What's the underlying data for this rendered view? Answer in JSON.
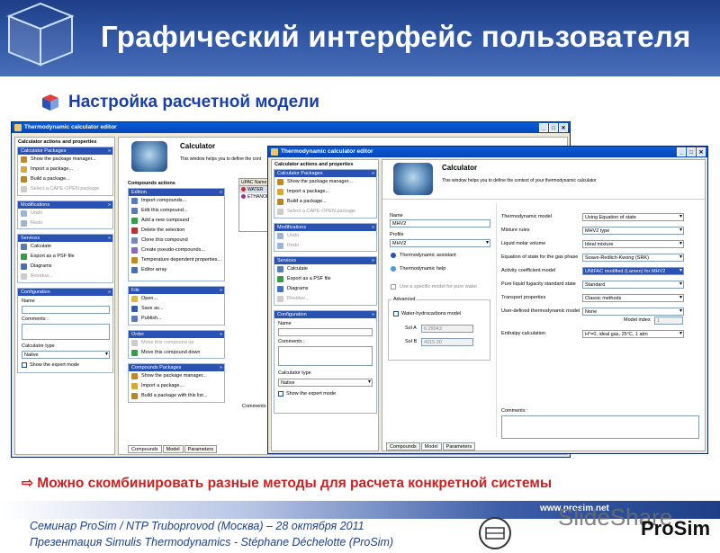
{
  "slide": {
    "title": "Графический интерфейс пользователя",
    "subtitle": "Настройка расчетной модели",
    "bottom_note": "⇨ Можно скомбинировать разные методы для расчета конкретной системы",
    "footer_line1": "Семинар ProSim / NTP Truboprovod (Москва) – 28 октября 2011",
    "footer_line2": "Презентация Simulis Thermodynamics - Stéphane Déchelotte (ProSim)",
    "footer_url": "www.prosim.net",
    "prosim_logo": "ProSim",
    "slideshare_wm": "SlideShare",
    "accent": "#1e3f88",
    "note_color": "#cc2020"
  },
  "back_window": {
    "title": "Thermodynamic calculator editor",
    "panel_title": "Calculator actions and properties",
    "sections": {
      "packages": {
        "header": "Calculator Packages",
        "items": [
          "Show the package manager...",
          "Import a package...",
          "Build a package...",
          "Select a CAPE-OPEN package"
        ]
      },
      "modifications": {
        "header": "Modifications",
        "items": [
          "Undo",
          "Redo"
        ]
      },
      "services": {
        "header": "Services",
        "items": [
          "Calculate",
          "Export as a PSF file",
          "Diagrams",
          "Residue..."
        ]
      },
      "configuration": {
        "header": "Configuration",
        "name_label": "Name",
        "comments_label": "Comments :",
        "type_label": "Calculator type",
        "type_value": "Native",
        "expert_label": "Show the expert mode"
      }
    },
    "calc_title": "Calculator",
    "calc_desc": "This window helps you to define the cont",
    "compounds_actions": "Compounds actions",
    "edition": {
      "header": "Edition",
      "items": [
        "Import compounds...",
        "Edit this compound...",
        "Add a new compound",
        "Delete the selection",
        "Clone this compound",
        "Create pseudo-compounds...",
        "Temperature dependent properties...",
        "Editor array"
      ]
    },
    "file": {
      "header": "File",
      "items": [
        "Open...",
        "Save as...",
        "Publish..."
      ]
    },
    "order": {
      "header": "Order",
      "items": [
        "Move this compound up",
        "Move this compound down"
      ]
    },
    "cpackages": {
      "header": "Compounds Packages",
      "items": [
        "Show the package manager...",
        "Import a package...",
        "Build a package with this list..."
      ]
    },
    "table": {
      "header": "UPAC Name",
      "rows": [
        "WATER",
        "ETHANOL"
      ]
    },
    "comments_label": "Comments :",
    "tabs": [
      "Compounds",
      "Model",
      "Parameters"
    ]
  },
  "front_window": {
    "title": "Thermodynamic calculator editor",
    "panel_title": "Calculator actions and properties",
    "sections": {
      "packages": {
        "header": "Calculator Packages",
        "items": [
          "Show the package manager...",
          "Import a package...",
          "Build a package...",
          "Select a CAPE-OPEN package"
        ]
      },
      "modifications": {
        "header": "Modifications",
        "items": [
          "Undo",
          "Redo"
        ]
      },
      "services": {
        "header": "Services",
        "items": [
          "Calculate",
          "Export as a PSF file",
          "Diagrams",
          "Residue..."
        ]
      },
      "configuration": {
        "header": "Configuration",
        "name_label": "Name",
        "comments_label": "Comments :",
        "type_label": "Calculator type",
        "type_value": "Native",
        "expert_label": "Show the expert mode"
      }
    },
    "calc_title": "Calculator",
    "calc_desc": "This window helps you to define the context of your thermodynamic calculator",
    "name_label": "Name",
    "name_value": "MHV2",
    "profile_label": "Profile",
    "profile_value": "MHV2",
    "assistant_label": "Thermodynamic assistant",
    "help_label": "Thermodynamic help",
    "specific_model_label": "Use a specific model for pure water",
    "advanced_label": "Advanced",
    "water_hc_label": "Water-hydrocarbons model",
    "sol_a_label": "Sol A",
    "sol_a_value": "6.29043",
    "sol_b_label": "Sol B",
    "sol_b_value": "4015.30",
    "props": [
      {
        "label": "Thermodynamic model",
        "value": "Using Equation of state"
      },
      {
        "label": "Mixture rules",
        "value": "MHV2 type"
      },
      {
        "label": "Liquid molar volume",
        "value": "Ideal mixture"
      },
      {
        "label": "Equation of state for the gas phase",
        "value": "Soave-Redlich-Kwong (SRK)"
      },
      {
        "label": "Activity coefficient model",
        "value": "UNIFAC modified (Larsen) for MHV2"
      },
      {
        "label": "Pure liquid fugacity standard state",
        "value": "Standard"
      },
      {
        "label": "Transport properties",
        "value": "Classic methods"
      },
      {
        "label": "User-defined thermodynamic model",
        "value": "None"
      }
    ],
    "model_index_label": "Model index",
    "model_index_value": "1",
    "enthalpy_label": "Enthalpy calculation",
    "enthalpy_value": "H°=0, ideal gas, 25°C, 1 atm",
    "comments_label": "Comments :",
    "tabs": [
      "Compounds",
      "Model",
      "Parameters"
    ]
  }
}
